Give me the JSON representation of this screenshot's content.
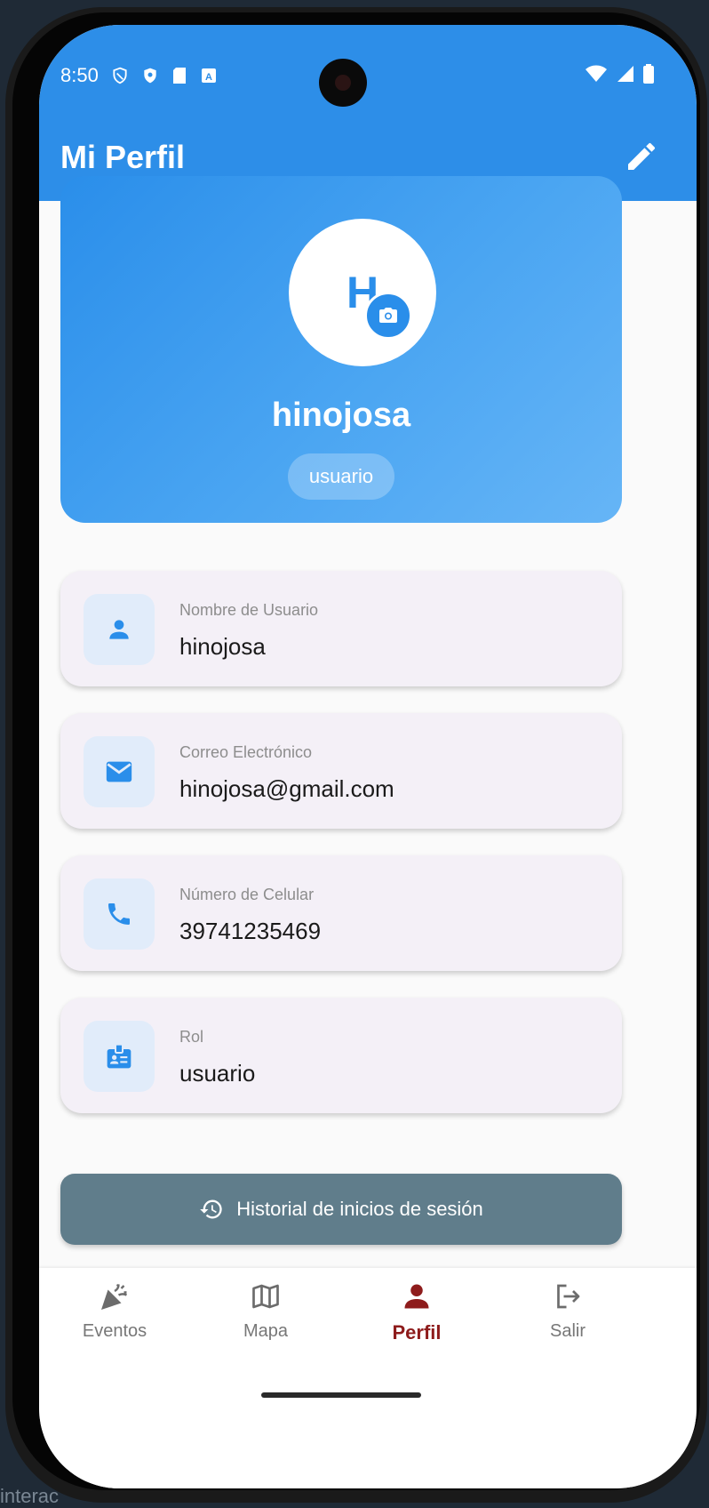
{
  "status_bar": {
    "time": "8:50"
  },
  "app_bar": {
    "title": "Mi Perfil"
  },
  "profile": {
    "initial": "H",
    "name": "hinojosa",
    "role_chip": "usuario"
  },
  "info_cards": [
    {
      "label": "Nombre de Usuario",
      "value": "hinojosa",
      "icon": "person-icon"
    },
    {
      "label": "Correo Electrónico",
      "value": "hinojosa@gmail.com",
      "icon": "email-icon"
    },
    {
      "label": "Número de Celular",
      "value": "39741235469",
      "icon": "phone-icon"
    },
    {
      "label": "Rol",
      "value": "usuario",
      "icon": "badge-icon"
    }
  ],
  "history_button": {
    "label": "Historial de inicios de sesión",
    "icon": "history-icon"
  },
  "bottom_nav": [
    {
      "label": "Eventos",
      "icon": "celebration-icon",
      "active": false
    },
    {
      "label": "Mapa",
      "icon": "map-icon",
      "active": false
    },
    {
      "label": "Perfil",
      "icon": "person-icon",
      "active": true
    },
    {
      "label": "Salir",
      "icon": "logout-icon",
      "active": false
    }
  ],
  "background_text": "interac",
  "colors": {
    "primary": "#2d8ee8",
    "active_nav": "#8e1c1c",
    "history_button": "#607d8b",
    "card_bg": "#f4f0f7",
    "icon_box_bg": "#e1ecfa"
  }
}
